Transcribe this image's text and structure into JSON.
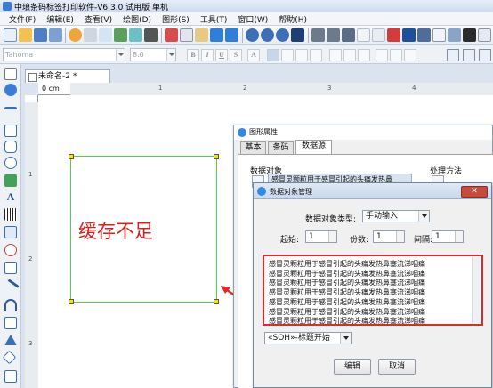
{
  "window": {
    "title": "中琅条码标签打印软件-V6.3.0 试用版 单机"
  },
  "menu": [
    "文件(F)",
    "编辑(E)",
    "查看(V)",
    "绘图(D)",
    "图形(S)",
    "工具(T)",
    "窗口(W)",
    "帮助(H)"
  ],
  "format_bar": {
    "font": "Tahoma",
    "size": "8.0"
  },
  "document": {
    "tab": "未命名-2 *",
    "ruler_unit": "0 cm",
    "ruler_marks": [
      "1",
      "2",
      "3",
      "4"
    ]
  },
  "canvas": {
    "label_text": "缓存不足"
  },
  "props_dialog": {
    "title": "图形属性",
    "tabs": [
      "基本",
      "条码",
      "数据源"
    ],
    "active_tab": "数据源",
    "section_data": "数据对象",
    "section_process": "处理方法",
    "source_item": "感冒灵颗粒用于感冒引起的头痛发热鼻"
  },
  "dom_dialog": {
    "title": "数据对象管理",
    "close": "✕",
    "type_label": "数据对象类型:",
    "type_value": "手动输入",
    "start_label": "起始:",
    "start_value": "1",
    "copies_label": "份数:",
    "copies_value": "1",
    "interval_label": "间隔:",
    "interval_value": "1",
    "lines": [
      "感冒灵颗粒用于感冒引起的头痛发热鼻塞流涕咽痛",
      "感冒灵颗粒用于感冒引起的头痛发热鼻塞流涕咽痛",
      "感冒灵颗粒用于感冒引起的头痛发热鼻塞流涕咽痛",
      "感冒灵颗粒用于感冒引起的头痛发热鼻塞流涕咽痛",
      "感冒灵颗粒用于感冒引起的头痛发热鼻塞流涕咽痛",
      "感冒灵颗粒用于感冒引起的头痛发热鼻塞流涕咽痛",
      "感冒灵颗粒用于感冒引起的头痛发热鼻塞流涕咽痛"
    ],
    "control_char": "«SOH»-标题开始",
    "edit_button": "编辑",
    "cancel_button": "取消"
  },
  "colors": {
    "highlight_border": "#e02a2a",
    "arrow": "#e02a2a",
    "label_text": "#d9211c",
    "selection_rect": "#4bd14b"
  }
}
